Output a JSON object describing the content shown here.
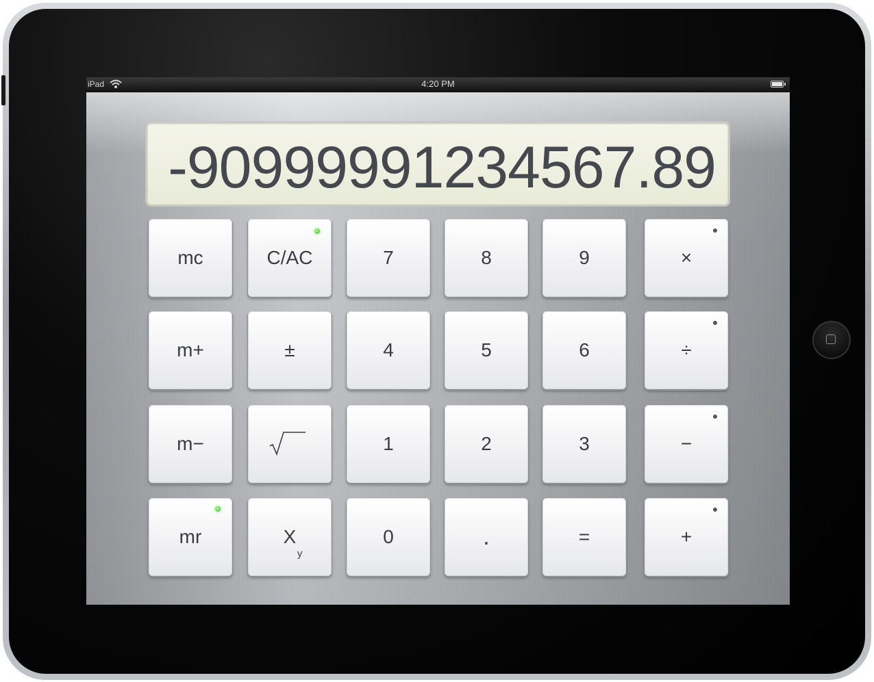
{
  "status_bar": {
    "device": "iPad",
    "time": "4:20 PM"
  },
  "display": {
    "value": "-90999991234567.89"
  },
  "keys": {
    "mc": "mc",
    "clear": "C/AC",
    "seven": "7",
    "eight": "8",
    "nine": "9",
    "multiply": "×",
    "m_plus": "m+",
    "plus_minus": "±",
    "four": "4",
    "five": "5",
    "six": "6",
    "divide": "÷",
    "m_minus": "m−",
    "one": "1",
    "two": "2",
    "three": "3",
    "subtract": "−",
    "mr": "mr",
    "x_power_base": "X",
    "x_power_exp": "y",
    "zero": "0",
    "decimal": ".",
    "equals": "=",
    "add": "+"
  },
  "icons": {
    "sqrt": "square-root-icon",
    "wifi": "wifi-icon",
    "battery": "battery-icon",
    "home": "home-button-icon"
  },
  "colors": {
    "led": "#3ccf2a",
    "display_bg": "#eef0df",
    "display_text": "#45484e"
  }
}
